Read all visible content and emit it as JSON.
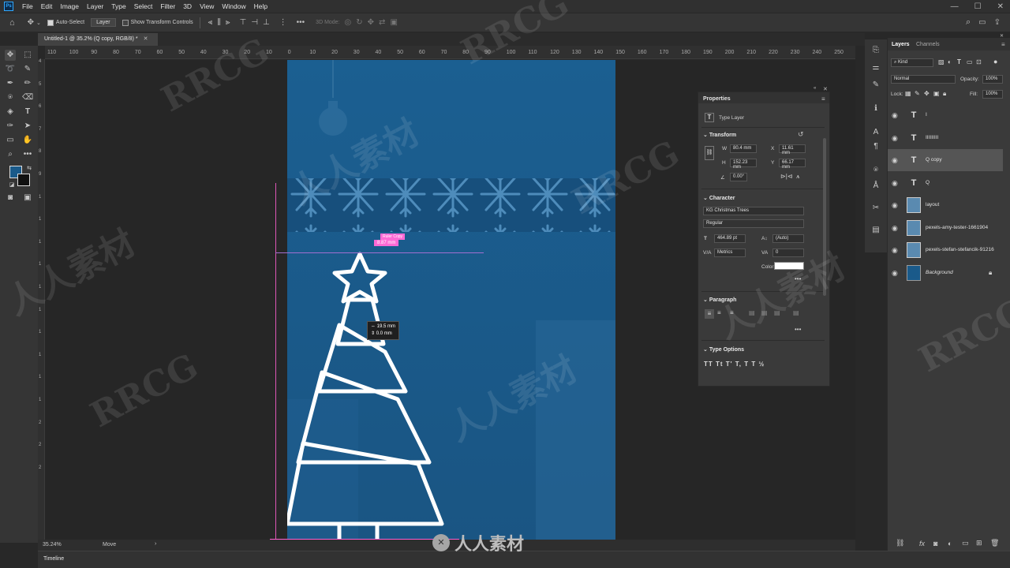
{
  "app": {
    "logo": "Ps"
  },
  "menus": [
    "File",
    "Edit",
    "Image",
    "Layer",
    "Type",
    "Select",
    "Filter",
    "3D",
    "View",
    "Window",
    "Help"
  ],
  "options_bar": {
    "auto_select_label": "Auto-Select",
    "auto_select_target": "Layer",
    "transform_controls_label": "Show Transform Controls",
    "three_d_mode": "3D Mode:"
  },
  "document": {
    "tab_title": "Untitled-1 @ 35.2% (Q copy, RGB/8) *"
  },
  "rulers": {
    "horizontal": [
      "110",
      "100",
      "90",
      "80",
      "70",
      "60",
      "50",
      "40",
      "30",
      "20",
      "10",
      "0",
      "10",
      "20",
      "30",
      "40",
      "50",
      "60",
      "70",
      "80",
      "90",
      "100",
      "110",
      "120",
      "130",
      "140",
      "150",
      "160",
      "170",
      "180",
      "190",
      "200",
      "210",
      "220",
      "230",
      "240",
      "250"
    ],
    "vertical": [
      "4",
      "5",
      "6",
      "7",
      "8",
      "9",
      "1",
      "1",
      "1",
      "1",
      "1",
      "1",
      "1",
      "1",
      "1",
      "1",
      "2",
      "2",
      "2"
    ]
  },
  "canvas_overlays": {
    "guide_tag_top": "Ruler Copy",
    "guide_tag_bottom": "8.87 mm",
    "measure_dx": "19.5 mm",
    "measure_dy": "0.0 mm"
  },
  "status_bar": {
    "zoom": "35.24%",
    "tool_hint": "Move"
  },
  "timeline": {
    "label": "Timeline"
  },
  "properties": {
    "title": "Properties",
    "layer_type": "Type Layer",
    "transform": {
      "title": "Transform",
      "w": "80.4 mm",
      "x": "11.61 mm",
      "h": "152.23 mm",
      "y": "66.17 mm",
      "angle": "0.00°"
    },
    "character": {
      "title": "Character",
      "font": "KG Christmas Trees",
      "style": "Regular",
      "size": "464.89 pt",
      "leading": "(Auto)",
      "kerning": "Metrics",
      "tracking": "0",
      "color_label": "Color"
    },
    "paragraph": {
      "title": "Paragraph"
    },
    "type_options": {
      "title": "Type Options",
      "glyphs": "TT Tt T' T, T T  ½"
    }
  },
  "layers_panel": {
    "tabs": [
      "Layers",
      "Channels"
    ],
    "filter_kind": "Kind",
    "blend_mode": "Normal",
    "opacity_label": "Opacity:",
    "opacity_value": "100%",
    "lock_label": "Lock:",
    "fill_label": "Fill:",
    "fill_value": "100%",
    "layers": [
      {
        "name": "I",
        "kind": "type"
      },
      {
        "name": "IIIIIIIII",
        "kind": "type"
      },
      {
        "name": "Q copy",
        "kind": "type",
        "selected": true
      },
      {
        "name": "Q",
        "kind": "type"
      },
      {
        "name": "layout",
        "kind": "image"
      },
      {
        "name": "pexels-amy-tester-1661904",
        "kind": "image"
      },
      {
        "name": "pexels-stefan-stefancik-91216",
        "kind": "image"
      },
      {
        "name": "Background",
        "kind": "fill",
        "locked": true
      }
    ]
  },
  "watermarks": [
    "RRCG",
    "人人素材",
    "RRCG",
    "人人素材",
    "RRCG",
    "人人素材",
    "RRCG",
    "人人素材",
    "RRCG"
  ],
  "bottom_logo_text": "人人素材",
  "colors": {
    "accent": "#31a8ff",
    "canvas_blue": "#1a5a8a",
    "guide_pink": "#ff5fd0"
  }
}
